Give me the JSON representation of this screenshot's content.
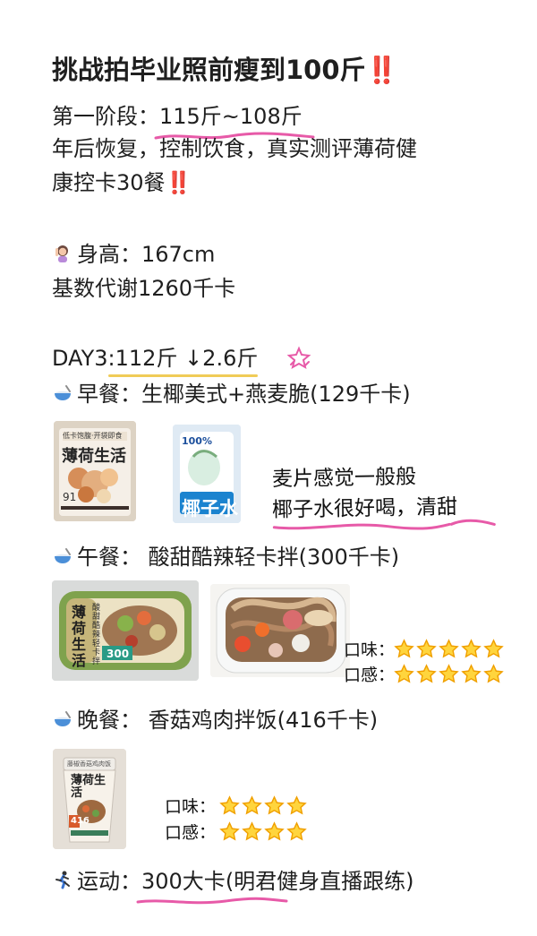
{
  "title": {
    "text": "挑战拍毕业照前瘦到100斤",
    "mark": "‼️"
  },
  "stage": {
    "label": "第一阶段：",
    "range": "115斤~108斤"
  },
  "intro": {
    "line1": "年后恢复，控制饮食，真实测评薄荷健",
    "line2": "康控卡30餐",
    "mark": "‼️"
  },
  "profile": {
    "height": "身高：167cm",
    "bmr": "基数代谢1260千卡"
  },
  "day": {
    "label": "DAY3",
    "colon": ":",
    "weight": "112斤 ↓2.6斤"
  },
  "breakfast": {
    "title": "早餐：生椰美式+燕麦脆(129千卡)",
    "package1_brand": "薄荷生活",
    "package1_top": "低卡饱腹·开袋即食",
    "package1_small": "91",
    "package2_percent": "100%",
    "package2_name": "椰子水",
    "note1": "麦片感觉一般般",
    "note2": "椰子水很好喝，清甜"
  },
  "lunch": {
    "title": "午餐：  酸甜酷辣轻卡拌(300千卡)",
    "box_brand": "薄荷生活",
    "box_flavor": "酸甜酷辣轻卡拌",
    "box_kcal": "300",
    "taste_label": "口味：",
    "texture_label": "口感：",
    "taste_stars": 5,
    "texture_stars": 5
  },
  "dinner": {
    "title": "晚餐：  香菇鸡肉拌饭(416千卡)",
    "cup_brand": "薄荷生活",
    "cup_top": "藤椒香菇鸡肉饭",
    "cup_kcal": "416",
    "taste_label": "口味：",
    "texture_label": "口感：",
    "taste_stars": 4,
    "texture_stars": 4
  },
  "exercise": {
    "label": "运动：",
    "value": "300大卡",
    "note": "(明君健身直播跟练)"
  },
  "colors": {
    "accent_red": "#ef3c35",
    "highlight_pink": "#e75aa8",
    "underline_yellow": "#f0cc57",
    "star_yellow": "#ffd53d",
    "star_outline": "#f0a000",
    "text": "#1f1f1f"
  }
}
